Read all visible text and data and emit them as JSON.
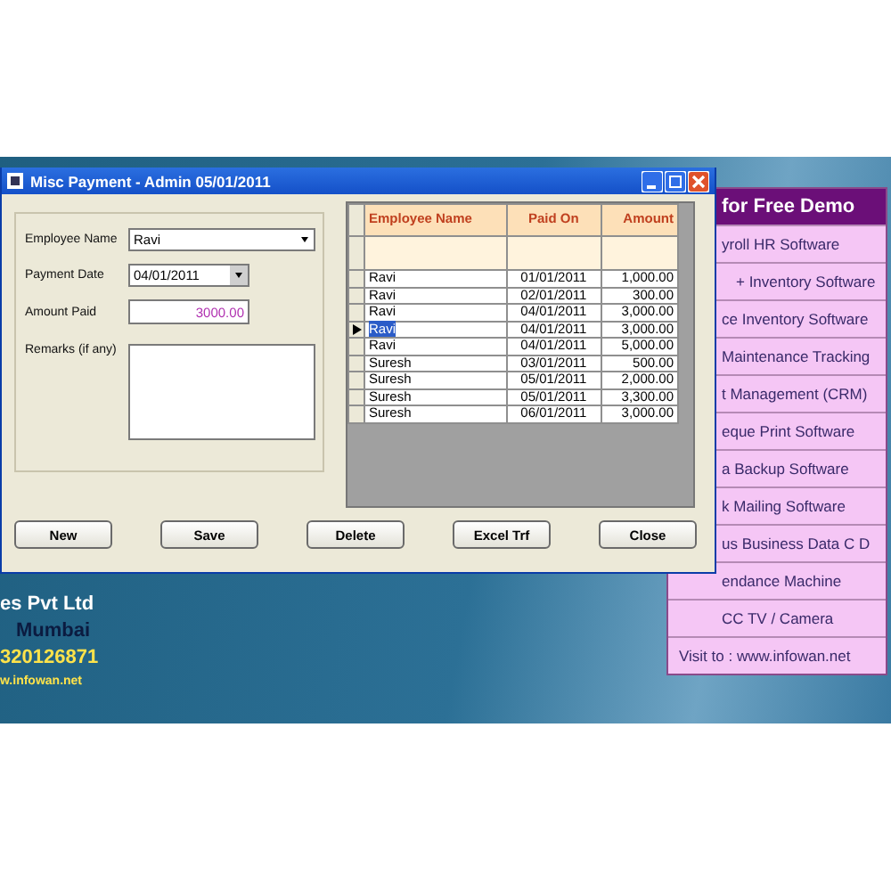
{
  "window": {
    "title": "Misc Payment - Admin  05/01/2011"
  },
  "form": {
    "employee_name": {
      "label": "Employee Name",
      "value": "Ravi"
    },
    "payment_date": {
      "label": "Payment Date",
      "value": "04/01/2011"
    },
    "amount_paid": {
      "label": "Amount Paid",
      "value": "3000.00"
    },
    "remarks": {
      "label": "Remarks (if any)"
    }
  },
  "table": {
    "columns": [
      "Employee Name",
      "Paid On",
      "Amount"
    ],
    "rows": [
      {
        "name": "Ravi",
        "paid_on": "01/01/2011",
        "amount": "1,000.00",
        "selected": false
      },
      {
        "name": "Ravi",
        "paid_on": "02/01/2011",
        "amount": "300.00",
        "selected": false
      },
      {
        "name": "Ravi",
        "paid_on": "04/01/2011",
        "amount": "3,000.00",
        "selected": false
      },
      {
        "name": "Ravi",
        "paid_on": "04/01/2011",
        "amount": "3,000.00",
        "selected": true
      },
      {
        "name": "Ravi",
        "paid_on": "04/01/2011",
        "amount": "5,000.00",
        "selected": false
      },
      {
        "name": "Suresh",
        "paid_on": "03/01/2011",
        "amount": "500.00",
        "selected": false
      },
      {
        "name": "Suresh",
        "paid_on": "05/01/2011",
        "amount": "2,000.00",
        "selected": false
      },
      {
        "name": "Suresh",
        "paid_on": "05/01/2011",
        "amount": "3,300.00",
        "selected": false
      },
      {
        "name": "Suresh",
        "paid_on": "06/01/2011",
        "amount": "3,000.00",
        "selected": false
      }
    ]
  },
  "buttons": [
    "New",
    "Save",
    "Delete",
    "Excel Trf",
    "Close"
  ],
  "promo": {
    "title": "for Free Demo",
    "items": [
      "yroll HR Software",
      "+ Inventory Software",
      "ce Inventory Software",
      "Maintenance Tracking",
      "t Management (CRM)",
      "eque Print Software",
      "a Backup Software",
      "k Mailing Software",
      "us Business Data C D",
      "endance Machine",
      "CC TV / Camera"
    ],
    "visit": "Visit to  : www.infowan.net"
  },
  "company": {
    "name": "es Pvt Ltd",
    "city": "Mumbai",
    "phone": "320126871",
    "website": "w.infowan.net"
  }
}
